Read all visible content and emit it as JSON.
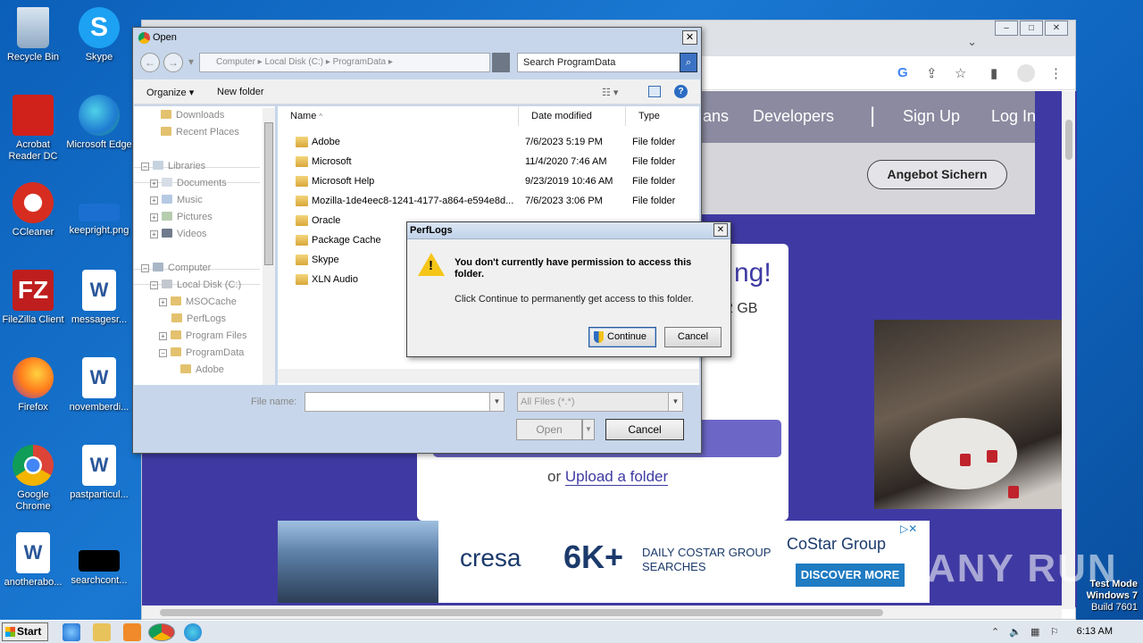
{
  "desktop": {
    "icons": [
      {
        "label": "Recycle Bin",
        "icon": "recycle-bin-icon",
        "color": "#9fb8d2"
      },
      {
        "label": "Skype",
        "icon": "skype-icon",
        "color": "#1da1f2"
      },
      {
        "label": "Acrobat Reader DC",
        "icon": "acrobat-icon",
        "color": "#d0211b"
      },
      {
        "label": "Microsoft Edge",
        "icon": "edge-icon",
        "color": "#1fa37a"
      },
      {
        "label": "CCleaner",
        "icon": "ccleaner-icon",
        "color": "#d62d20"
      },
      {
        "label": "keepright.png",
        "icon": "image-file-icon",
        "color": "#1a6fd0"
      },
      {
        "label": "FileZilla Client",
        "icon": "filezilla-icon",
        "color": "#bf1e1e"
      },
      {
        "label": "messagesr...",
        "icon": "word-doc-icon",
        "color": "#ffffff"
      },
      {
        "label": "Firefox",
        "icon": "firefox-icon",
        "color": "#ff7b1c"
      },
      {
        "label": "novemberdi...",
        "icon": "word-doc-icon",
        "color": "#ffffff"
      },
      {
        "label": "Google Chrome",
        "icon": "chrome-icon",
        "color": "#34a853"
      },
      {
        "label": "pastparticul...",
        "icon": "word-doc-icon",
        "color": "#ffffff"
      },
      {
        "label": "anotherabo...",
        "icon": "word-doc-icon",
        "color": "#ffffff"
      },
      {
        "label": "searchcont...",
        "icon": "black-file-icon",
        "color": "#000000"
      }
    ]
  },
  "browser": {
    "nav": [
      "ans",
      "Developers",
      "Sign Up",
      "Log In"
    ],
    "angebot": "Angebot Sichern",
    "card_big": "ng!",
    "card_gb": "2 GB",
    "upload_or": "or",
    "upload_link": "Upload a folder",
    "ad": {
      "cresa": "cresa",
      "sixk": "6K+",
      "daily1": "DAILY COSTAR GROUP",
      "daily2": "SEARCHES",
      "costar": "CoStar Group",
      "discover": "DISCOVER MORE"
    }
  },
  "open_dialog": {
    "title": "Open",
    "breadcrumb": "Computer  ▸  Local Disk (C:)  ▸  ProgramData  ▸",
    "search_placeholder": "Search ProgramData",
    "organize": "Organize ▾",
    "new_folder": "New folder",
    "tree": [
      {
        "label": "Downloads",
        "indent": 0
      },
      {
        "label": "Recent Places",
        "indent": 0
      },
      {
        "label": "Libraries",
        "indent": 0
      },
      {
        "label": "Documents",
        "indent": 1
      },
      {
        "label": "Music",
        "indent": 1
      },
      {
        "label": "Pictures",
        "indent": 1
      },
      {
        "label": "Videos",
        "indent": 1
      },
      {
        "label": "Computer",
        "indent": 0
      },
      {
        "label": "Local Disk (C:)",
        "indent": 1
      },
      {
        "label": "MSOCache",
        "indent": 2
      },
      {
        "label": "PerfLogs",
        "indent": 2
      },
      {
        "label": "Program Files",
        "indent": 2
      },
      {
        "label": "ProgramData",
        "indent": 2
      },
      {
        "label": "Adobe",
        "indent": 3
      }
    ],
    "columns": [
      "Name",
      "Date modified",
      "Type"
    ],
    "rows": [
      {
        "name": "Adobe",
        "date": "7/6/2023 5:19 PM",
        "type": "File folder"
      },
      {
        "name": "Microsoft",
        "date": "11/4/2020 7:46 AM",
        "type": "File folder"
      },
      {
        "name": "Microsoft Help",
        "date": "9/23/2019 10:46 AM",
        "type": "File folder"
      },
      {
        "name": "Mozilla-1de4eec8-1241-4177-a864-e594e8d...",
        "date": "7/6/2023 3:06 PM",
        "type": "File folder"
      },
      {
        "name": "Oracle",
        "date": "",
        "type": ""
      },
      {
        "name": "Package Cache",
        "date": "",
        "type": ""
      },
      {
        "name": "Skype",
        "date": "",
        "type": ""
      },
      {
        "name": "XLN Audio",
        "date": "",
        "type": ""
      }
    ],
    "file_name_label": "File name:",
    "file_type": "All Files (*.*)",
    "open_label": "Open",
    "cancel_label": "Cancel"
  },
  "perm_dialog": {
    "title": "PerfLogs",
    "message": "You don't currently have permission to access this folder.",
    "sub": "Click Continue to permanently get access to this folder.",
    "continue_label": "Continue",
    "cancel_label": "Cancel"
  },
  "taskbar": {
    "start": "Start",
    "clock": "6:13 AM"
  },
  "watermark": {
    "line1": "Test Mode",
    "line2": "Windows 7",
    "line3": "Build 7601",
    "anyrun": "ANY RUN"
  }
}
